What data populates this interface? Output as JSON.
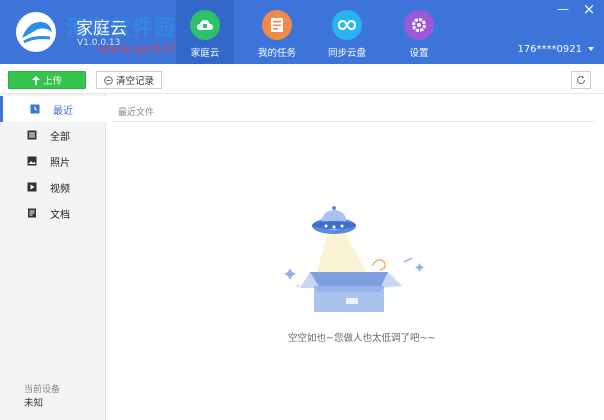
{
  "header": {
    "app_title": "家庭云",
    "version": "V1.0.0.13",
    "watermark": "河东软件园",
    "watermark_url": "www.pc0359.cn",
    "nav": [
      {
        "label": "家庭云",
        "icon": "cloud-home-icon",
        "color": "#2fc06a",
        "active": true
      },
      {
        "label": "我的任务",
        "icon": "task-list-icon",
        "color": "#f08a4b",
        "active": false
      },
      {
        "label": "同步云盘",
        "icon": "sync-cloud-icon",
        "color": "#27b5f2",
        "active": false
      },
      {
        "label": "设置",
        "icon": "settings-gear-icon",
        "color": "#9b59d6",
        "active": false
      }
    ],
    "window_controls": {
      "minimize": "—",
      "close": "×"
    },
    "user": "176****0921"
  },
  "toolbar": {
    "upload_label": "上传",
    "clear_label": "清空记录"
  },
  "sidebar": {
    "items": [
      {
        "label": "最近",
        "icon": "clock-icon",
        "active": true
      },
      {
        "label": "全部",
        "icon": "grid-list-icon",
        "active": false
      },
      {
        "label": "照片",
        "icon": "image-icon",
        "active": false
      },
      {
        "label": "视频",
        "icon": "video-play-icon",
        "active": false
      },
      {
        "label": "文档",
        "icon": "document-icon",
        "active": false
      }
    ],
    "device_label": "当前设备",
    "device_value": "未知"
  },
  "content": {
    "section_title": "最近文件",
    "empty_message": "空空如也~您做人也太低调了吧~~"
  },
  "colors": {
    "header_bg": "#3d74d9",
    "upload_green": "#34c34b",
    "accent": "#3d74d9"
  }
}
